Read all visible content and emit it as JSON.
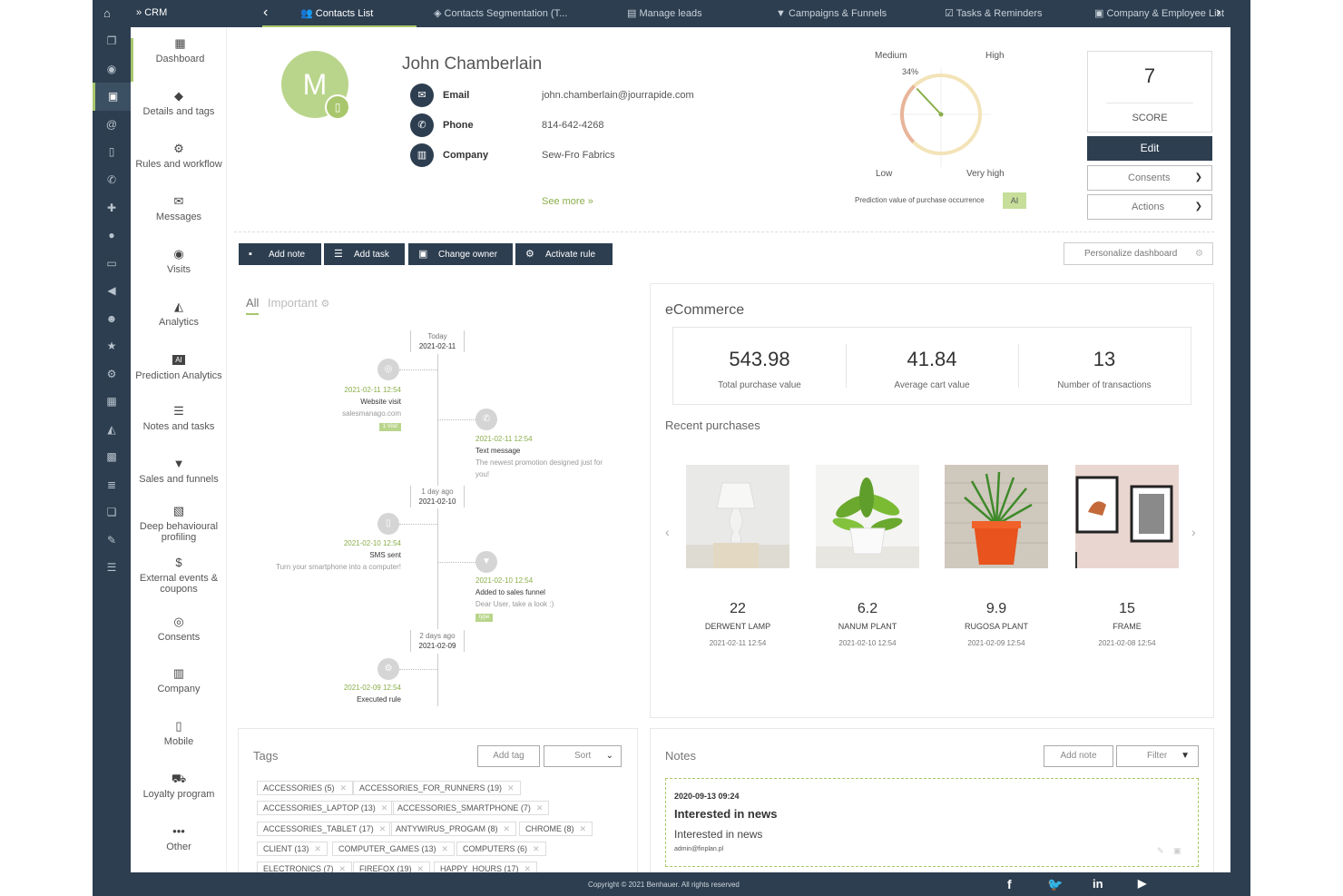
{
  "topbar": {
    "app_label": "CRM",
    "tabs": [
      {
        "label": "Contacts List"
      },
      {
        "label": "Contacts Segmentation (T..."
      },
      {
        "label": "Manage leads"
      },
      {
        "label": "Campaigns & Funnels"
      },
      {
        "label": "Tasks & Reminders"
      },
      {
        "label": "Company & Employee List"
      }
    ]
  },
  "sidenav": {
    "items": [
      {
        "label": "Dashboard",
        "icon": "dashboard-icon"
      },
      {
        "label": "Details and tags",
        "icon": "tags-icon"
      },
      {
        "label": "Rules and workflow",
        "icon": "gears-icon"
      },
      {
        "label": "Messages",
        "icon": "envelope-icon"
      },
      {
        "label": "Visits",
        "icon": "eye-icon"
      },
      {
        "label": "Analytics",
        "icon": "area-chart-icon"
      },
      {
        "label": "Prediction Analytics",
        "icon": "ai-icon"
      },
      {
        "label": "Notes and tasks",
        "icon": "list-icon"
      },
      {
        "label": "Sales and funnels",
        "icon": "funnel-icon"
      },
      {
        "label": "Deep behavioural profiling",
        "icon": "profile-icon"
      },
      {
        "label": "External events & coupons",
        "icon": "dollar-icon"
      },
      {
        "label": "Consents",
        "icon": "handshake-icon"
      },
      {
        "label": "Company",
        "icon": "building-icon"
      },
      {
        "label": "Mobile",
        "icon": "mobile-icon"
      },
      {
        "label": "Loyalty program",
        "icon": "cart-icon"
      },
      {
        "label": "Other",
        "icon": "ellipsis-icon"
      }
    ]
  },
  "contact": {
    "initial": "M",
    "name": "John Chamberlain",
    "email_label": "Email",
    "email": "john.chamberlain@jourrapide.com",
    "phone_label": "Phone",
    "phone": "814-642-4268",
    "company_label": "Company",
    "company": "Sew-Fro Fabrics",
    "see_more": "See more"
  },
  "gauge": {
    "medium": "Medium",
    "high": "High",
    "low": "Low",
    "very_high": "Very high",
    "percent_label": "34%",
    "value": 0.34,
    "caption": "Prediction value of purchase occurrence",
    "badge": "AI"
  },
  "score": {
    "value": "7",
    "label": "SCORE"
  },
  "buttons": {
    "edit": "Edit",
    "consents": "Consents",
    "actions": "Actions",
    "add_note": "Add note",
    "add_task": "Add task",
    "change_owner": "Change owner",
    "activate_rule": "Activate rule",
    "personalize": "Personalize dashboard"
  },
  "timeline": {
    "tab_all": "All",
    "tab_important": "Important",
    "dates": [
      {
        "rel": "Today",
        "date": "2021-02-11"
      },
      {
        "rel": "1 day ago",
        "date": "2021-02-10"
      },
      {
        "rel": "2 days ago",
        "date": "2021-02-09"
      }
    ],
    "events": [
      {
        "time": "2021-02-11 12:54",
        "name": "Website visit",
        "detail": "salesmanago.com",
        "badge": "1 Visit"
      },
      {
        "time": "2021-02-11 12:54",
        "name": "Text message",
        "detail": "The newest promotion designed just for you!"
      },
      {
        "time": "2021-02-10 12:54",
        "name": "SMS sent",
        "detail": "Turn your smartphone into a computer!"
      },
      {
        "time": "2021-02-10 12:54",
        "name": "Added to sales funnel",
        "detail": "Dear User, take a look :)",
        "badge": "type"
      },
      {
        "time": "2021-02-09 12:54",
        "name": "Executed rule"
      }
    ]
  },
  "ecommerce": {
    "title": "eCommerce",
    "stats": [
      {
        "value": "543.98",
        "label": "Total purchase value"
      },
      {
        "value": "41.84",
        "label": "Average cart value"
      },
      {
        "value": "13",
        "label": "Number of transactions"
      }
    ],
    "recent_title": "Recent purchases",
    "products": [
      {
        "value": "22",
        "name": "DERWENT LAMP",
        "date": "2021-02-11 12:54"
      },
      {
        "value": "6.2",
        "name": "NANUM PLANT",
        "date": "2021-02-10 12:54"
      },
      {
        "value": "9.9",
        "name": "RUGOSA PLANT",
        "date": "2021-02-09 12:54"
      },
      {
        "value": "15",
        "name": "FRAME",
        "date": "2021-02-08 12:54"
      }
    ]
  },
  "tags": {
    "title": "Tags",
    "add_tag": "Add tag",
    "sort": "Sort",
    "items": [
      "ACCESSORIES (5)",
      "ACCESSORIES_FOR_RUNNERS (19)",
      "ACCESSORIES_LAPTOP (13)",
      "ACCESSORIES_SMARTPHONE (7)",
      "ACCESSORIES_TABLET (17)",
      "ANTYWIRUS_PROGAM (8)",
      "CHROME (8)",
      "CLIENT (13)",
      "COMPUTER_GAMES (13)",
      "COMPUTERS (6)",
      "ELECTRONICS (7)",
      "FIREFOX (19)",
      "HAPPY_HOURS (17)"
    ]
  },
  "notes": {
    "title": "Notes",
    "add_note": "Add note",
    "filter": "Filter",
    "items": [
      {
        "date": "2020-09-13 09:24",
        "title": "Interested in news",
        "body": "Interested in news",
        "author": "admin@finplan.pl"
      }
    ]
  },
  "footer": {
    "copyright": "Copyright © 2021 Benhauer. All rights reserved",
    "social": [
      "facebook-icon",
      "twitter-icon",
      "linkedin-icon",
      "youtube-icon"
    ]
  },
  "colors": {
    "navy": "#2d3e50",
    "accent": "#a8c76d",
    "avatar": "#b9d58b"
  }
}
